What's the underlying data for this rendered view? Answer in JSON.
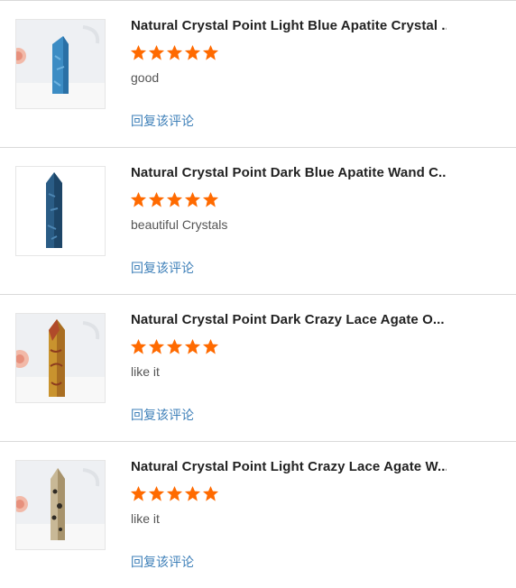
{
  "reviews": [
    {
      "title": "Natural Crystal Point Light Blue Apatite Crystal ...",
      "rating": 5,
      "comment": "good",
      "reply_label": "回复该评论",
      "thumbnail": {
        "subject": "light-blue-apatite-crystal-point",
        "color": "#3c8cc4"
      }
    },
    {
      "title": "Natural Crystal Point Dark Blue Apatite Wand C...",
      "rating": 5,
      "comment": "beautiful Crystals",
      "reply_label": "回复该评论",
      "thumbnail": {
        "subject": "dark-blue-apatite-wand",
        "color": "#2a5c85"
      }
    },
    {
      "title": "Natural Crystal Point Dark Crazy Lace Agate O...",
      "rating": 5,
      "comment": "like it",
      "reply_label": "回复该评论",
      "thumbnail": {
        "subject": "dark-crazy-lace-agate-point",
        "color": "#c9932e"
      }
    },
    {
      "title": "Natural Crystal Point Light Crazy Lace Agate W...",
      "rating": 5,
      "comment": "like it",
      "reply_label": "回复该评论",
      "thumbnail": {
        "subject": "light-crazy-lace-agate-point",
        "color": "#b8a585"
      }
    }
  ],
  "colors": {
    "star": "#ff6a00",
    "reply_link": "#3d7fb8",
    "title": "#222222",
    "comment": "#555555",
    "divider": "#d9d9d9"
  },
  "icons": {
    "star": "star-icon"
  }
}
